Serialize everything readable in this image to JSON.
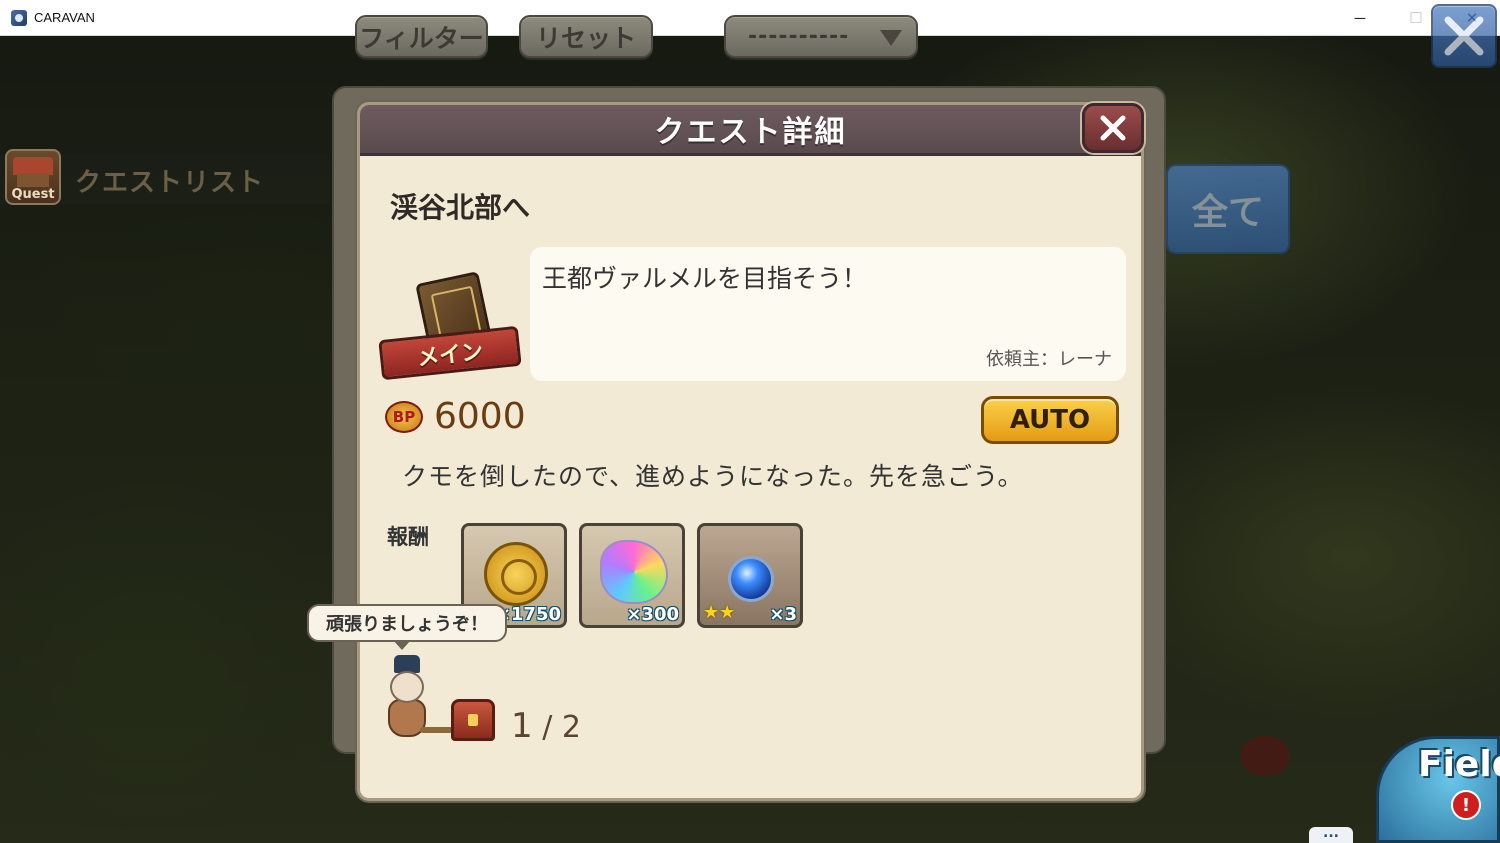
{
  "window": {
    "title": "CARAVAN",
    "minimize": "─",
    "maximize": "☐",
    "close": "✕"
  },
  "toolbar": {
    "filter_label": "フィルター",
    "reset_label": "リセット",
    "sort_value": "----------"
  },
  "sidebar": {
    "icon_label": "Quest",
    "list_label": "クエストリスト"
  },
  "all_button_label": "全て",
  "dialog": {
    "title": "クエスト詳細",
    "quest_name": "渓谷北部へ",
    "category_badge": "メイン",
    "description": "王都ヴァルメルを目指そう！",
    "client": "依頼主：レーナ",
    "bp_icon_label": "BP",
    "bp_value": "6000",
    "auto_label": "AUTO",
    "message": "クモを倒したので、進めようになった。先を急ごう。",
    "reward_label": "報酬",
    "rewards": [
      {
        "icon": "gold-coin-icon",
        "quantity": "×1750"
      },
      {
        "icon": "rainbow-crystal-icon",
        "quantity": "×300"
      },
      {
        "icon": "blue-orb-icon",
        "quantity": "×3",
        "stars": "★★"
      }
    ],
    "speech": "頑張りましょうぞ！",
    "progress_current": "1",
    "progress_sep": "/",
    "progress_total": "2"
  },
  "field_button": {
    "label": "Field",
    "alert": "!",
    "more": "..."
  },
  "colors": {
    "header": "#5a4a4e",
    "auto_button": "#f3b52d",
    "panel": "#f3ead6",
    "close_blue": "#3d69ab"
  }
}
